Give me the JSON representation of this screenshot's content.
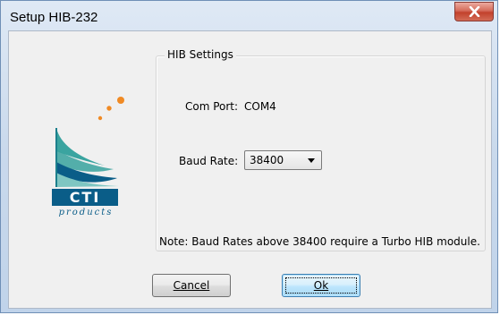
{
  "window": {
    "title": "Setup HIB-232"
  },
  "logo": {
    "name": "CTI",
    "sub": "products"
  },
  "group": {
    "legend": "HIB Settings"
  },
  "com_port": {
    "label": "Com Port:",
    "value": "COM4"
  },
  "baud_rate": {
    "label": "Baud Rate:",
    "value": "38400"
  },
  "note": "Note: Baud Rates above 38400 require a Turbo HIB module.",
  "buttons": {
    "cancel": "Cancel",
    "ok": "Ok"
  },
  "colors": {
    "titlebar": "#c9d9ec",
    "close_button": "#c2412c",
    "logo_blue": "#0a5d88",
    "logo_teal": "#3aa4a0",
    "logo_orange": "#f08a24",
    "ok_button": "#bee6fd"
  }
}
